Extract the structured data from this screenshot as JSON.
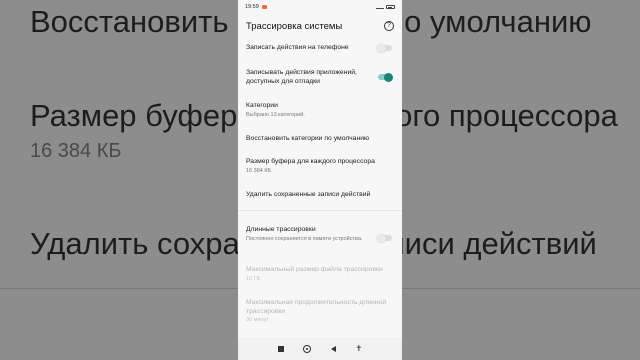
{
  "background": {
    "line1": "Восстановить категории по умолчанию",
    "line2": "Размер буфера для каждого процессора",
    "line2_sub": "16 384 КБ",
    "line3": "Удалить сохраненные записи действий"
  },
  "status_bar": {
    "time": "19:59"
  },
  "app_bar": {
    "title": "Трассировка системы",
    "help_icon": "?"
  },
  "settings": {
    "record_phone": {
      "title": "Записать действия на телефоне",
      "enabled": false
    },
    "record_apps": {
      "title": "Записывать действия приложений, доступных для отладки",
      "enabled": true
    },
    "categories": {
      "title": "Категории",
      "subtitle": "Выбрано 13 категорий."
    },
    "restore_defaults": {
      "title": "Восстановить категории по умолчанию"
    },
    "buffer_size": {
      "title": "Размер буфера для каждого процессора",
      "subtitle": "16 384 КБ"
    },
    "delete_records": {
      "title": "Удалить сохраненные записи действий"
    },
    "long_traces": {
      "title": "Длинные трассировки",
      "subtitle": "Постоянно сохраняется в памяти устройства.",
      "enabled": false
    },
    "max_file_size": {
      "title": "Максимальный размер файла трассировки",
      "subtitle": "10 ГБ"
    },
    "max_duration": {
      "title": "Максимальная продолжительность длинной трассировки",
      "subtitle": "30 минут"
    }
  },
  "nav_bar": {
    "accessibility_glyph": "✝"
  }
}
